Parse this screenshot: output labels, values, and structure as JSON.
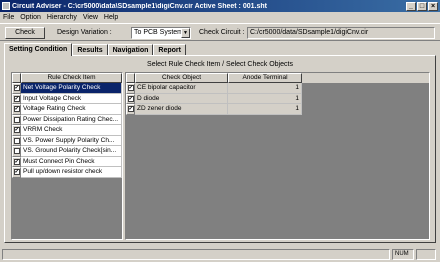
{
  "window": {
    "title": "Circuit Adviser - C:\\cr5000\\data\\SDsample1\\digiCnv.cir  Active Sheet : 001.sht"
  },
  "menu": [
    "File",
    "Option",
    "Hierarchy",
    "View",
    "Help"
  ],
  "toolbar": {
    "check_label": "Check",
    "design_variation_label": "Design Variation :",
    "design_variation_value": "To PCB System",
    "check_circuit_label": "Check Circuit :",
    "check_circuit_path": "C:/cr5000/data/SDsample1/digiCnv.cir"
  },
  "tabs": [
    "Setting Condition",
    "Results",
    "Navigation",
    "Report"
  ],
  "panel": {
    "section_title": "Select Rule Check Item / Select Check Objects"
  },
  "rule_table": {
    "header": "Rule Check Item",
    "rows": [
      {
        "label": "Net Voltage Polarity Check",
        "checked": true,
        "selected": true
      },
      {
        "label": "Input Voltage Check",
        "checked": true,
        "selected": false
      },
      {
        "label": "Voltage Rating Check",
        "checked": true,
        "selected": false
      },
      {
        "label": "Power Dissipation Rating Chec...",
        "checked": false,
        "selected": false
      },
      {
        "label": "VRRM Check",
        "checked": true,
        "selected": false
      },
      {
        "label": "VS. Power Supply Polarity Ch...",
        "checked": false,
        "selected": false
      },
      {
        "label": "VS. Ground Polarity Check[sin...",
        "checked": false,
        "selected": false
      },
      {
        "label": "Must Connect Pin Check",
        "checked": true,
        "selected": false
      },
      {
        "label": "Pull up/down resistor check",
        "checked": true,
        "selected": false
      }
    ]
  },
  "object_table": {
    "headers": [
      "Check Object",
      "Anode Terminal"
    ],
    "rows": [
      {
        "object": "CE bipolar capacitor",
        "terminal": "1",
        "checked": true
      },
      {
        "object": "D diode",
        "terminal": "1",
        "checked": true
      },
      {
        "object": "ZD zener diode",
        "terminal": "1",
        "checked": true
      }
    ]
  },
  "status": {
    "num": "NUM"
  }
}
